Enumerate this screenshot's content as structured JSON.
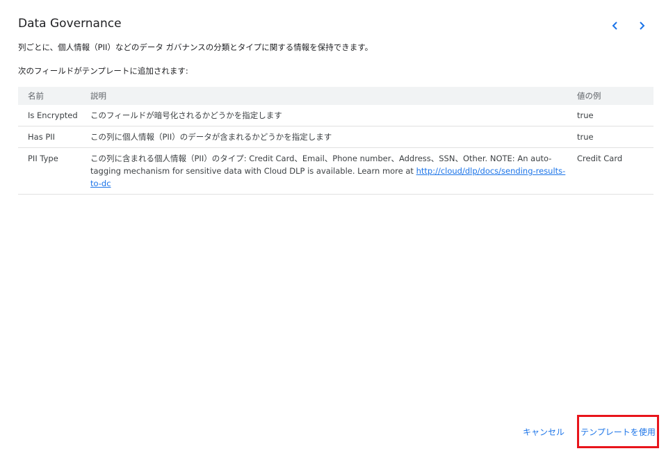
{
  "header": {
    "title": "Data Governance",
    "description": "列ごとに、個人情報（PII）などのデータ ガバナンスの分類とタイプに関する情報を保持できます。",
    "fields_intro": "次のフィールドがテンプレートに追加されます:"
  },
  "nav": {
    "prev_icon": "chevron-left-icon",
    "next_icon": "chevron-right-icon",
    "color": "#1a73e8"
  },
  "table": {
    "headers": {
      "name": "名前",
      "description": "説明",
      "example": "値の例"
    },
    "rows": [
      {
        "name": "Is Encrypted",
        "description": "このフィールドが暗号化されるかどうかを指定します",
        "example": "true"
      },
      {
        "name": "Has PII",
        "description": "この列に個人情報（PII）のデータが含まれるかどうかを指定します",
        "example": "true"
      },
      {
        "name": "PII Type",
        "description": "この列に含まれる個人情報（PII）のタイプ: Credit Card、Email、Phone number、Address、SSN、Other. NOTE: An auto-tagging mechanism for sensitive data with Cloud DLP is available. Learn more at ",
        "link": "http://cloud/dlp/docs/sending-results-to-dc",
        "example": "Credit Card"
      }
    ]
  },
  "footer": {
    "cancel_label": "キャンセル",
    "use_label": "テンプレートを使用",
    "highlight_color": "#e8141b"
  }
}
